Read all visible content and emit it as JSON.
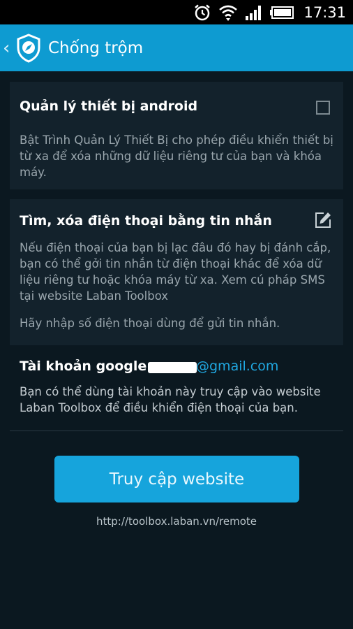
{
  "status_bar": {
    "time": "17:31",
    "icons": [
      "alarm-icon",
      "wifi-icon",
      "signal-icon",
      "battery-icon"
    ]
  },
  "action_bar": {
    "title": "Chống trộm",
    "back_icon": "chevron-left-icon",
    "app_icon": "shield-compass-icon"
  },
  "cards": [
    {
      "title": "Quản lý thiết bị android",
      "description": "Bật Trình Quản Lý Thiết Bị cho phép điều khiển thiết bị từ xa để xóa những dữ liệu riêng tư của bạn và khóa máy.",
      "control": "checkbox",
      "checked": false
    },
    {
      "title": "Tìm, xóa điện thoại bằng tin nhắn",
      "description": "Nếu điện thoại của bạn bị lạc đâu đó hay bị đánh cắp, bạn có thể gởi tin nhắn từ điện thoại khác để xóa dữ liệu riêng tư hoặc khóa máy từ xa. Xem cú pháp SMS tại website Laban Toolbox",
      "hint": "Hãy nhập số điện thoại dùng để gửi tin nhắn.",
      "control": "edit-icon"
    }
  ],
  "account": {
    "label": "Tài khoản google:",
    "email_domain": "@gmail.com",
    "description": "Bạn có thể dùng tài khoản này truy cập vào website Laban Toolbox để điều khiển điện thoại của bạn."
  },
  "button": {
    "label": "Truy cập website"
  },
  "url": "http://toolbox.laban.vn/remote",
  "colors": {
    "accent": "#0e9bd1",
    "button": "#16a4dc",
    "background": "#0b1820",
    "card": "#13222c",
    "link": "#20a7e0"
  }
}
